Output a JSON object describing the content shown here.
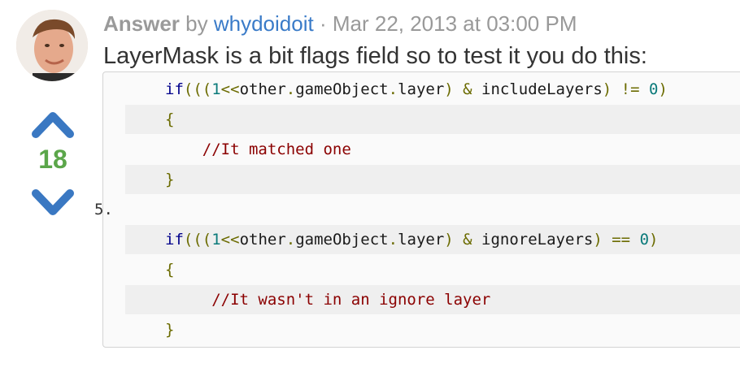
{
  "post": {
    "label": "Answer",
    "by": "by",
    "author": "whydoidoit",
    "separator": "·",
    "date": "Mar 22, 2013 at 03:00 PM",
    "intro": "LayerMask is a bit flags field so to test it you do this:"
  },
  "votes": {
    "count": "18",
    "up_icon": "chevron-up-icon",
    "down_icon": "chevron-down-icon",
    "color": "#3a78c2"
  },
  "code": {
    "line_number": "5.",
    "lines": [
      {
        "tokens": [
          {
            "t": "if",
            "c": "kw"
          },
          {
            "t": "(((",
            "c": "op"
          },
          {
            "t": "1",
            "c": "num"
          },
          {
            "t": "<<",
            "c": "op"
          },
          {
            "t": "other",
            "c": "id"
          },
          {
            "t": ".",
            "c": "op"
          },
          {
            "t": "gameObject",
            "c": "id"
          },
          {
            "t": ".",
            "c": "op"
          },
          {
            "t": "layer",
            "c": "id"
          },
          {
            "t": ") ",
            "c": "op"
          },
          {
            "t": "&",
            "c": "op"
          },
          {
            "t": " includeLayers",
            "c": "id"
          },
          {
            "t": ") ",
            "c": "op"
          },
          {
            "t": "!=",
            "c": "op"
          },
          {
            "t": " ",
            "c": "id"
          },
          {
            "t": "0",
            "c": "num"
          },
          {
            "t": ")",
            "c": "op"
          }
        ]
      },
      {
        "tokens": [
          {
            "t": "{",
            "c": "op"
          }
        ]
      },
      {
        "tokens": [
          {
            "t": "    //It matched one",
            "c": "cm"
          }
        ]
      },
      {
        "tokens": [
          {
            "t": "}",
            "c": "op"
          }
        ]
      },
      {
        "tokens": [
          {
            "t": "",
            "c": "id"
          }
        ]
      },
      {
        "tokens": [
          {
            "t": "if",
            "c": "kw"
          },
          {
            "t": "(((",
            "c": "op"
          },
          {
            "t": "1",
            "c": "num"
          },
          {
            "t": "<<",
            "c": "op"
          },
          {
            "t": "other",
            "c": "id"
          },
          {
            "t": ".",
            "c": "op"
          },
          {
            "t": "gameObject",
            "c": "id"
          },
          {
            "t": ".",
            "c": "op"
          },
          {
            "t": "layer",
            "c": "id"
          },
          {
            "t": ") ",
            "c": "op"
          },
          {
            "t": "&",
            "c": "op"
          },
          {
            "t": " ignoreLayers",
            "c": "id"
          },
          {
            "t": ") ",
            "c": "op"
          },
          {
            "t": "==",
            "c": "op"
          },
          {
            "t": " ",
            "c": "id"
          },
          {
            "t": "0",
            "c": "num"
          },
          {
            "t": ")",
            "c": "op"
          }
        ]
      },
      {
        "tokens": [
          {
            "t": "{",
            "c": "op"
          }
        ]
      },
      {
        "tokens": [
          {
            "t": "     //It wasn't in an ignore layer",
            "c": "cm"
          }
        ]
      },
      {
        "tokens": [
          {
            "t": "}",
            "c": "op"
          }
        ]
      }
    ]
  }
}
